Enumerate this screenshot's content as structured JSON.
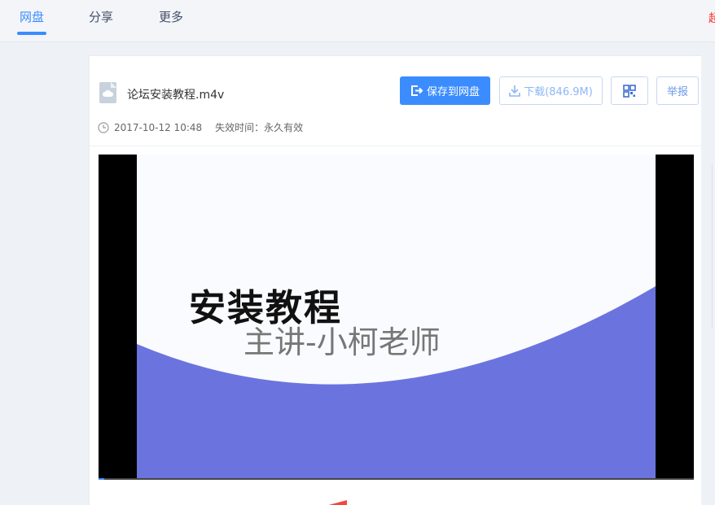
{
  "nav": {
    "tabs": [
      "网盘",
      "分享",
      "更多"
    ],
    "edge_text": "超"
  },
  "file": {
    "name": "论坛安装教程.m4v",
    "date": "2017-10-12 10:48",
    "expire_label": "失效时间：",
    "expire_value": "永久有效"
  },
  "actions": {
    "save_label": "保存到网盘",
    "download_label": "下载(846.9M)",
    "report_label": "举报"
  },
  "video": {
    "title": "安装教程",
    "subtitle": "主讲-小柯老师",
    "progress": 0.01
  },
  "colors": {
    "accent": "#3b8cff",
    "wave": "#6b74de"
  }
}
